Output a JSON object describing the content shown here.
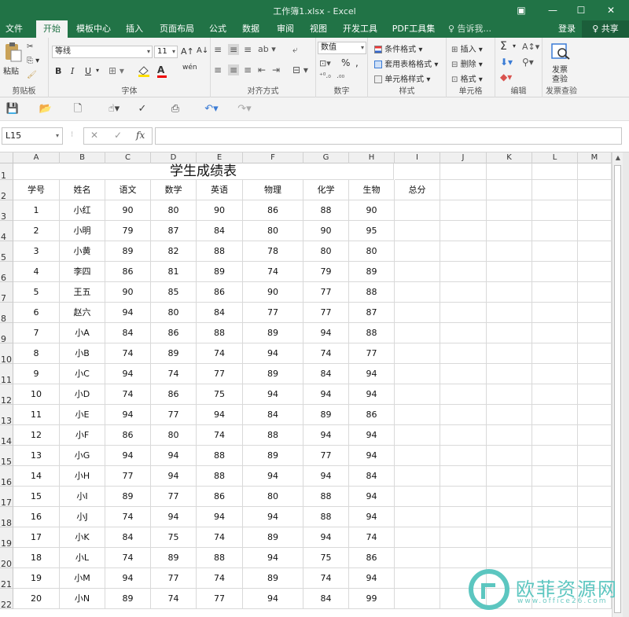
{
  "window": {
    "title": "工作簿1.xlsx - Excel",
    "controls": [
      "▣",
      "—",
      "☐",
      "✕"
    ]
  },
  "tabs": [
    {
      "label": "文件"
    },
    {
      "label": "开始"
    },
    {
      "label": "模板中心"
    },
    {
      "label": "插入"
    },
    {
      "label": "页面布局"
    },
    {
      "label": "公式"
    },
    {
      "label": "数据"
    },
    {
      "label": "审阅"
    },
    {
      "label": "视图"
    },
    {
      "label": "开发工具"
    },
    {
      "label": "PDF工具集"
    }
  ],
  "tell_me": "♀ 告诉我...",
  "login": "登录",
  "share": "♀ 共享",
  "ribbon": {
    "clipboard": {
      "paste": "粘贴",
      "label": "剪贴板"
    },
    "font": {
      "name": "等线",
      "size": "11",
      "grow": "A↑",
      "shrink": "A↓",
      "bold": "B",
      "italic": "I",
      "underline": "U",
      "wen": "wén",
      "label": "字体"
    },
    "align": {
      "label": "对齐方式"
    },
    "number": {
      "format": "数值",
      "percent": "%",
      "comma": ",",
      "label": "数字"
    },
    "styles": {
      "cond": "条件格式",
      "table": "套用表格格式",
      "cell": "单元格样式",
      "label": "样式"
    },
    "cells": {
      "insert": "插入",
      "delete": "删除",
      "format": "格式",
      "label": "单元格"
    },
    "editing": {
      "sum": "Σ",
      "label": "编辑"
    },
    "invoice": {
      "btn_line1": "发票",
      "btn_line2": "查验",
      "label": "发票查验"
    }
  },
  "formula_bar": {
    "name_box": "L15",
    "cancel": "✕",
    "enter": "✓",
    "fx": "fx",
    "content": ""
  },
  "columns": [
    "A",
    "B",
    "C",
    "D",
    "E",
    "F",
    "G",
    "H",
    "I",
    "J",
    "K",
    "L",
    "M"
  ],
  "row_numbers": [
    "1",
    "2",
    "3",
    "4",
    "5",
    "6",
    "7",
    "8",
    "9",
    "10",
    "11",
    "12",
    "13",
    "14",
    "15",
    "16",
    "17",
    "18",
    "19",
    "20",
    "21",
    "22"
  ],
  "sheet": {
    "title": "学生成绩表",
    "headers": [
      "学号",
      "姓名",
      "语文",
      "数学",
      "英语",
      "物理",
      "化学",
      "生物",
      "总分"
    ],
    "rows": [
      [
        "1",
        "小红",
        "90",
        "80",
        "90",
        "86",
        "88",
        "90"
      ],
      [
        "2",
        "小明",
        "79",
        "87",
        "84",
        "80",
        "90",
        "95"
      ],
      [
        "3",
        "小黄",
        "89",
        "82",
        "88",
        "78",
        "80",
        "80"
      ],
      [
        "4",
        "李四",
        "86",
        "81",
        "89",
        "74",
        "79",
        "89"
      ],
      [
        "5",
        "王五",
        "90",
        "85",
        "86",
        "90",
        "77",
        "88"
      ],
      [
        "6",
        "赵六",
        "94",
        "80",
        "84",
        "77",
        "77",
        "87"
      ],
      [
        "7",
        "小A",
        "84",
        "86",
        "88",
        "89",
        "94",
        "88"
      ],
      [
        "8",
        "小B",
        "74",
        "89",
        "74",
        "94",
        "74",
        "77"
      ],
      [
        "9",
        "小C",
        "94",
        "74",
        "77",
        "89",
        "84",
        "94"
      ],
      [
        "10",
        "小D",
        "74",
        "86",
        "75",
        "94",
        "94",
        "94"
      ],
      [
        "11",
        "小E",
        "94",
        "77",
        "94",
        "84",
        "89",
        "86"
      ],
      [
        "12",
        "小F",
        "86",
        "80",
        "74",
        "88",
        "94",
        "94"
      ],
      [
        "13",
        "小G",
        "94",
        "94",
        "88",
        "89",
        "77",
        "94"
      ],
      [
        "14",
        "小H",
        "77",
        "94",
        "88",
        "94",
        "94",
        "84"
      ],
      [
        "15",
        "小I",
        "89",
        "77",
        "86",
        "80",
        "88",
        "94"
      ],
      [
        "16",
        "小J",
        "74",
        "94",
        "94",
        "94",
        "88",
        "94"
      ],
      [
        "17",
        "小K",
        "84",
        "75",
        "74",
        "89",
        "94",
        "74"
      ],
      [
        "18",
        "小L",
        "74",
        "89",
        "88",
        "94",
        "75",
        "86"
      ],
      [
        "19",
        "小M",
        "94",
        "77",
        "74",
        "89",
        "74",
        "94"
      ],
      [
        "20",
        "小N",
        "89",
        "74",
        "77",
        "94",
        "84",
        "99"
      ]
    ]
  },
  "watermark": {
    "text": "欧菲资源网",
    "url": "www.office26.com"
  }
}
